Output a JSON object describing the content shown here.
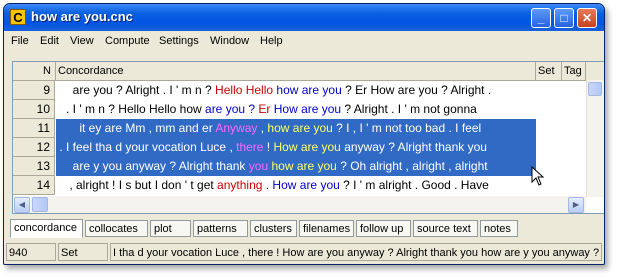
{
  "window": {
    "title": "how are you.cnc",
    "app_icon_letter": "C"
  },
  "title_buttons": {
    "minimize": "_",
    "maximize": "□",
    "close": "✕"
  },
  "menu": [
    "File",
    "Edit",
    "View",
    "Compute",
    "Settings",
    "Window",
    "Help"
  ],
  "grid": {
    "columns": {
      "n": "N",
      "concordance": "Concordance",
      "set": "Set",
      "tag": "Tag"
    },
    "rows": [
      {
        "n": "9",
        "selected": false,
        "segments": [
          {
            "text": "     are you ? Alright . I ' m n ? ",
            "color": "#000000"
          },
          {
            "text": "Hello Hello",
            "color": "#cc0000"
          },
          {
            "text": " how are you",
            "color": "#0000cc"
          },
          {
            "text": " ? Er How are you ? Alright .",
            "color": "#000000"
          }
        ]
      },
      {
        "n": "10",
        "selected": false,
        "segments": [
          {
            "text": "   . I ' m n ? Hello Hello how ",
            "color": "#000000"
          },
          {
            "text": "are you ? ",
            "color": "#0000cc"
          },
          {
            "text": "Er",
            "color": "#cc0000"
          },
          {
            "text": " How are you",
            "color": "#0000cc"
          },
          {
            "text": " ? Alright . I ' m not gonna",
            "color": "#000000"
          }
        ]
      },
      {
        "n": "11",
        "selected": true,
        "segments": [
          {
            "text": "       it ey are Mm , mm and er ",
            "color": "#ffffff"
          },
          {
            "text": "Anyway",
            "color": "#ff66ff"
          },
          {
            "text": " , ",
            "color": "#ffffff"
          },
          {
            "text": "how are you",
            "color": "#ffff66"
          },
          {
            "text": " ? I , I ' m not too bad . I feel",
            "color": "#ffffff"
          }
        ]
      },
      {
        "n": "12",
        "selected": true,
        "segments": [
          {
            "text": " . I feel tha d your vocation Luce , ",
            "color": "#ffffff"
          },
          {
            "text": "there",
            "color": "#ff66ff"
          },
          {
            "text": " ! ",
            "color": "#ffffff"
          },
          {
            "text": "How are you",
            "color": "#ffff66"
          },
          {
            "text": " anyway ? Alright thank you",
            "color": "#ffffff"
          }
        ]
      },
      {
        "n": "13",
        "selected": true,
        "segments": [
          {
            "text": "     are y you anyway ? Alright thank ",
            "color": "#ffffff"
          },
          {
            "text": "you",
            "color": "#ff66ff"
          },
          {
            "text": " how are you",
            "color": "#ffff66"
          },
          {
            "text": " ? Oh alright , alright , alright",
            "color": "#ffffff"
          }
        ]
      },
      {
        "n": "14",
        "selected": false,
        "segments": [
          {
            "text": "    , alright ! I s but I don ' t get ",
            "color": "#000000"
          },
          {
            "text": "anything",
            "color": "#cc0000"
          },
          {
            "text": " . How are you",
            "color": "#0000cc"
          },
          {
            "text": " ? I ' m alright . Good . Have",
            "color": "#000000"
          }
        ]
      }
    ]
  },
  "tabs": [
    "concordance",
    "collocates",
    "plot",
    "patterns",
    "clusters",
    "filenames",
    "follow up",
    "source text",
    "notes"
  ],
  "active_tab": "concordance",
  "status": {
    "count": "940",
    "field": "Set",
    "text": "I tha d your vocation Luce , there ! How are you anyway ? Alright thank you how are y you anyway ?"
  },
  "colors": {
    "titlebar": "#0055e5",
    "selection": "#316ac5",
    "chrome": "#ece9d8"
  }
}
